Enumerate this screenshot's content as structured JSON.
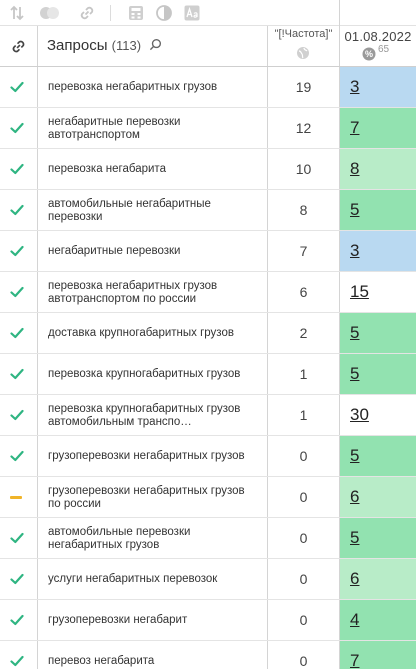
{
  "header": {
    "queries_label": "Запросы",
    "queries_count": "(113)",
    "freq_label": "\"[!Частота]\"",
    "date_label": "01.08.2022",
    "pct_value": "65"
  },
  "colors": {
    "blue_cell": "#b9d9f1",
    "green_cell": "#92e2b0",
    "light_green_cell": "#b8ecc8",
    "check": "#2fb582",
    "dash": "#f0b429"
  },
  "rows": [
    {
      "status": "check",
      "query": "перевозка негабаритных грузов",
      "freq": "19",
      "position": "3",
      "color": "blue"
    },
    {
      "status": "check",
      "query": "негабаритные перевозки автотранспортом",
      "freq": "12",
      "position": "7",
      "color": "green"
    },
    {
      "status": "check",
      "query": "перевозка негабарита",
      "freq": "10",
      "position": "8",
      "color": "lightgreen"
    },
    {
      "status": "check",
      "query": "автомобильные негабаритные перевозки",
      "freq": "8",
      "position": "5",
      "color": "green"
    },
    {
      "status": "check",
      "query": "негабаритные перевозки",
      "freq": "7",
      "position": "3",
      "color": "blue"
    },
    {
      "status": "check",
      "query": "перевозка негабаритных грузов автотранспортом по россии",
      "freq": "6",
      "position": "15",
      "color": "white"
    },
    {
      "status": "check",
      "query": "доставка крупногабаритных грузов",
      "freq": "2",
      "position": "5",
      "color": "green"
    },
    {
      "status": "check",
      "query": "перевозка крупногабаритных грузов",
      "freq": "1",
      "position": "5",
      "color": "green"
    },
    {
      "status": "check",
      "query": "перевозка крупногабаритных грузов автомобильным транспо…",
      "freq": "1",
      "position": "30",
      "color": "white"
    },
    {
      "status": "check",
      "query": "грузоперевозки негабаритных грузов",
      "freq": "0",
      "position": "5",
      "color": "green"
    },
    {
      "status": "dash",
      "query": "грузоперевозки негабаритных грузов по россии",
      "freq": "0",
      "position": "6",
      "color": "lightgreen"
    },
    {
      "status": "check",
      "query": "автомобильные перевозки негабаритных грузов",
      "freq": "0",
      "position": "5",
      "color": "green"
    },
    {
      "status": "check",
      "query": "услуги негабаритных перевозок",
      "freq": "0",
      "position": "6",
      "color": "lightgreen"
    },
    {
      "status": "check",
      "query": "грузоперевозки негабарит",
      "freq": "0",
      "position": "4",
      "color": "green"
    },
    {
      "status": "check",
      "query": "перевоз негабарита",
      "freq": "0",
      "position": "7",
      "color": "green"
    }
  ]
}
